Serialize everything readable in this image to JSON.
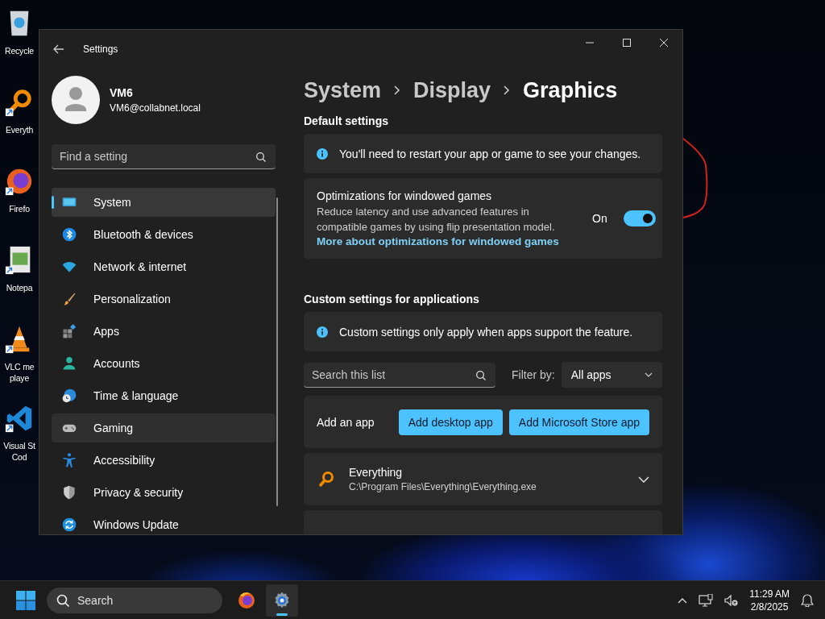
{
  "desktop_icons": [
    {
      "kind": "recycle",
      "lines": [
        "Recycle"
      ]
    },
    {
      "kind": "everything",
      "lines": [
        "Everyth"
      ]
    },
    {
      "kind": "firefox",
      "lines": [
        "Firefo"
      ]
    },
    {
      "kind": "notepad",
      "lines": [
        "Notepa"
      ]
    },
    {
      "kind": "vlc",
      "lines": [
        "VLC me",
        "playe"
      ]
    },
    {
      "kind": "vscode",
      "lines": [
        "Visual St",
        "Cod"
      ]
    }
  ],
  "window": {
    "title": "Settings",
    "user": {
      "name": "VM6",
      "email": "VM6@collabnet.local"
    },
    "search": {
      "placeholder": "Find a setting"
    },
    "nav": [
      {
        "label": "System",
        "kind": "system",
        "selected": true,
        "hovered": false
      },
      {
        "label": "Bluetooth & devices",
        "kind": "bluetooth",
        "selected": false,
        "hovered": false
      },
      {
        "label": "Network & internet",
        "kind": "network",
        "selected": false,
        "hovered": false
      },
      {
        "label": "Personalization",
        "kind": "brush",
        "selected": false,
        "hovered": false
      },
      {
        "label": "Apps",
        "kind": "apps",
        "selected": false,
        "hovered": false
      },
      {
        "label": "Accounts",
        "kind": "accounts",
        "selected": false,
        "hovered": false
      },
      {
        "label": "Time & language",
        "kind": "time",
        "selected": false,
        "hovered": false
      },
      {
        "label": "Gaming",
        "kind": "gaming",
        "selected": false,
        "hovered": true
      },
      {
        "label": "Accessibility",
        "kind": "accessibility",
        "selected": false,
        "hovered": false
      },
      {
        "label": "Privacy & security",
        "kind": "privacy",
        "selected": false,
        "hovered": false
      },
      {
        "label": "Windows Update",
        "kind": "update",
        "selected": false,
        "hovered": false
      }
    ],
    "breadcrumb": [
      "System",
      "Display",
      "Graphics"
    ],
    "default_settings": {
      "heading": "Default settings",
      "info": "You'll need to restart your app or game to see your changes.",
      "toggle": {
        "title": "Optimizations for windowed games",
        "description": "Reduce latency and use advanced features in compatible games by using flip presentation model.",
        "link": "More about optimizations for windowed games",
        "state_label": "On",
        "on": true
      }
    },
    "custom_settings": {
      "heading": "Custom settings for applications",
      "info": "Custom settings only apply when apps support the feature.",
      "search": {
        "placeholder": "Search this list"
      },
      "filter": {
        "label": "Filter by:",
        "value": "All apps"
      },
      "add_app": {
        "label": "Add an app",
        "buttons": [
          "Add desktop app",
          "Add Microsoft Store app"
        ]
      },
      "apps": [
        {
          "kind": "everything",
          "name": "Everything",
          "path": "C:\\Program Files\\Everything\\Everything.exe"
        }
      ]
    }
  },
  "taskbar": {
    "search": "Search",
    "apps": [
      {
        "kind": "firefox",
        "active": false
      },
      {
        "kind": "settings",
        "active": true
      }
    ],
    "time": "11:29 AM",
    "date": "2/8/2025"
  }
}
